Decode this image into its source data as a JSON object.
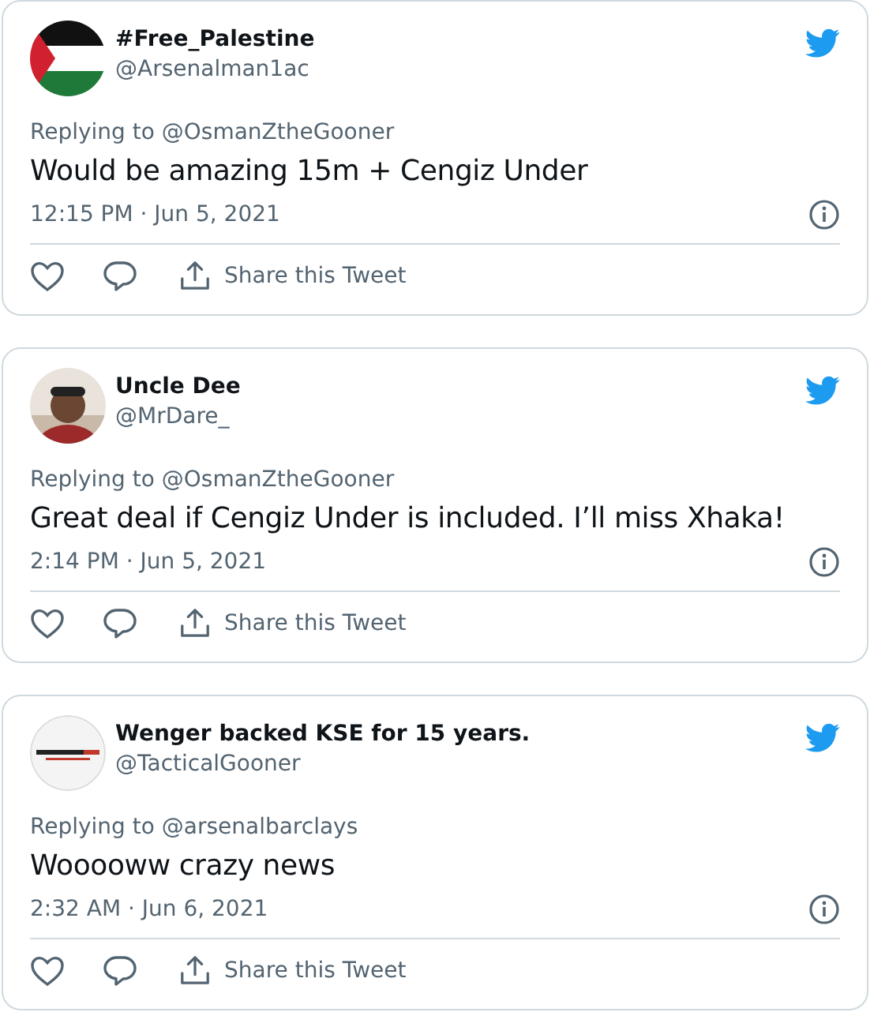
{
  "tweets": [
    {
      "kind": "flag",
      "name": "#Free_Palestine",
      "handle": "@Arsenalman1ac",
      "replying": "Replying to @OsmanZtheGooner",
      "text": "Would be amazing 15m + Cengiz Under",
      "time": "12:15 PM · Jun 5, 2021",
      "share": "Share this Tweet"
    },
    {
      "kind": "person",
      "name": "Uncle Dee",
      "handle": "@MrDare_",
      "replying": "Replying to @OsmanZtheGooner",
      "text": "Great deal if Cengiz Under is included. I’ll miss Xhaka!",
      "time": "2:14 PM · Jun 5, 2021",
      "share": "Share this Tweet"
    },
    {
      "kind": "logo",
      "name": "Wenger backed KSE for 15 years.",
      "handle": "@TacticalGooner",
      "replying": "Replying to @arsenalbarclays",
      "text": "Wooooww crazy news",
      "time": "2:32 AM · Jun 6, 2021",
      "share": "Share this Tweet"
    }
  ]
}
